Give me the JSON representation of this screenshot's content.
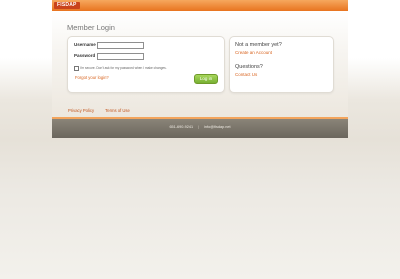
{
  "header": {
    "logo_text": "FISDAP"
  },
  "login": {
    "title": "Member Login",
    "username_label": "Username",
    "password_label": "Password",
    "remember_label": "I'm secure. Don't ask for my password when I make changes.",
    "forgot_link": "Forgot your login?",
    "submit_label": "Log in"
  },
  "side": {
    "not_member": "Not a member yet?",
    "create_account": "Create an Account",
    "questions": "Questions?",
    "contact_us": "Contact Us"
  },
  "footer": {
    "privacy": "Privacy Policy",
    "terms": "Terms of Use",
    "phone": "651-690-9241",
    "email": "info@fisdap.net"
  },
  "colors": {
    "accent": "#e8741f",
    "link": "#d8631e",
    "button": "#8cc440",
    "footer_bar": "#7a756b"
  }
}
